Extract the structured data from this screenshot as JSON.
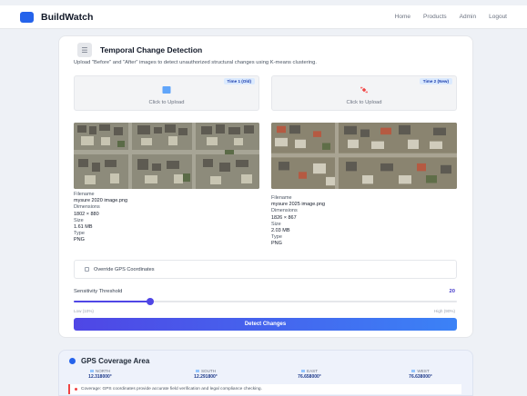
{
  "nav": {
    "brand": "BuildWatch",
    "links": [
      "Home",
      "Products",
      "Admin",
      "Logout"
    ]
  },
  "main": {
    "title": "Temporal Change Detection",
    "description": "Upload \"Before\" and \"After\" images to detect unauthorized structural changes using K-means clustering.",
    "upload1": {
      "badge": "Time 1 (Old)",
      "label": "Click to Upload"
    },
    "upload2": {
      "badge": "Time 2 (New)",
      "label": "Click to Upload"
    },
    "meta1": {
      "filename_label": "Filename",
      "filename": "mysure 2020 image.png",
      "dims_label": "Dimensions",
      "dims": "1802 × 880",
      "size_label": "Size",
      "size": "1.61 MB",
      "type_label": "Type",
      "type": "PNG"
    },
    "meta2": {
      "filename_label": "Filename",
      "filename": "mysure 2025 image.png",
      "dims_label": "Dimensions",
      "dims": "1826 × 867",
      "size_label": "Size",
      "size": "2.03 MB",
      "type_label": "Type",
      "type": "PNG"
    },
    "gps_override_label": "Override GPS Coordinates",
    "sensitivity_label": "Sensitivity Threshold",
    "sensitivity_value": "20",
    "sensitivity_fraction": 0.2,
    "slider_min": "Low (10%)",
    "slider_max": "High (90%)",
    "detect_button": "Detect Changes"
  },
  "gps": {
    "title": "GPS Coverage Area",
    "coords": [
      {
        "label": "NORTH",
        "value": "12.318000°"
      },
      {
        "label": "SOUTH",
        "value": "12.291800°"
      },
      {
        "label": "EAST",
        "value": "76.658000°"
      },
      {
        "label": "WEST",
        "value": "76.638000°"
      }
    ],
    "note": "Coverage: GPS coordinates provide accurate field verification and legal compliance checking."
  },
  "colors": {
    "accent": "#4f46e5",
    "brand": "#2563eb",
    "alert": "#ef4444"
  }
}
